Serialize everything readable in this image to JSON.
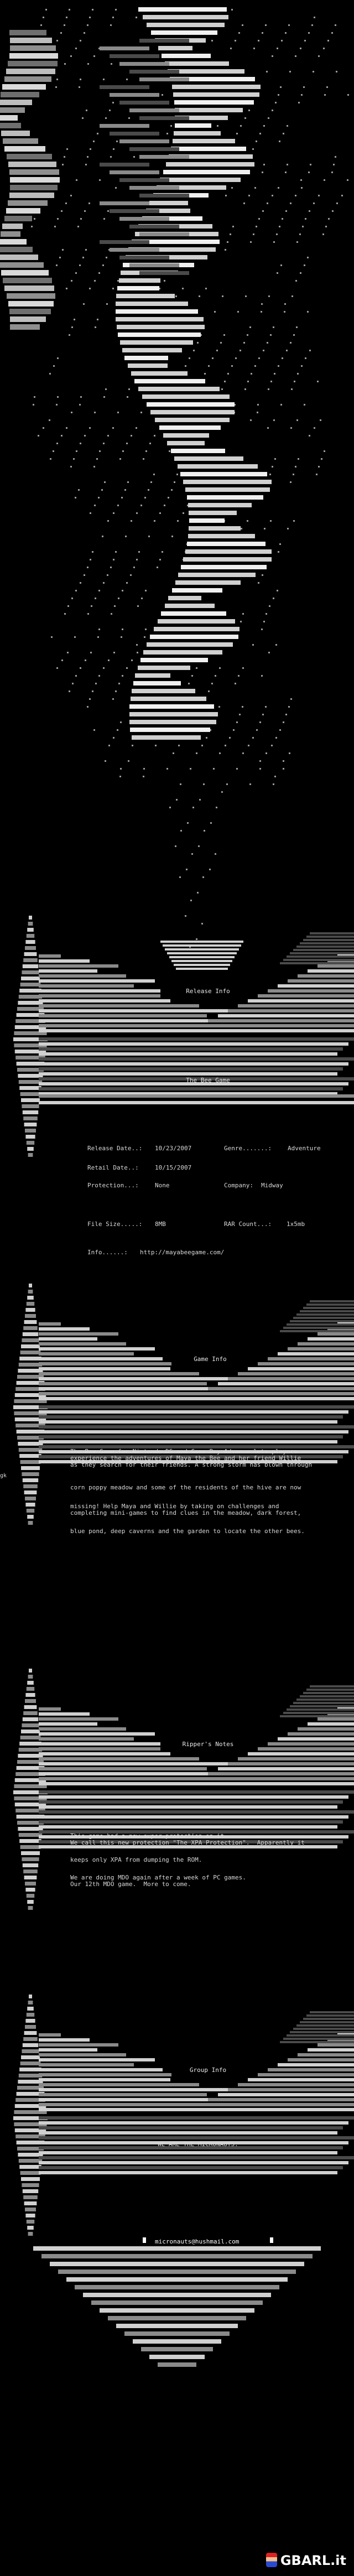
{
  "headers": {
    "release_info": "Release Info",
    "game_info": "Game Info",
    "rippers_notes": "Ripper's Notes",
    "group_info": "Group Info"
  },
  "game_title": "The Bee Game",
  "release": {
    "release_date_label": "Release Date..:",
    "release_date": "10/23/2007",
    "genre_label": "Genre.......:",
    "genre": "Adventure",
    "retail_date_label": "Retail Date..:",
    "retail_date": "10/15/2007",
    "protection_label": "Protection...:",
    "protection": "None",
    "company_label": "Company:",
    "company": "Midway",
    "file_size_label": "File Size.....:",
    "file_size": "8MB",
    "rar_count_label": "RAR Count...:",
    "rar_count": "1x5mb",
    "info_label": "Info......:",
    "info_url": "http://mayabeegame.com/"
  },
  "side_marker": "gk",
  "game_info_paragraphs": [
    "The Bee Game for Nintendo DS and Game Boy Advance lets players\nexperience the adventures of Maya the Bee and her friend Willie\nas they search for their friends. A strong storm has blown through",
    "corn poppy meadow and some of the residents of the hive are now",
    "missing! Help Maya and Willie by taking on challenges and\ncompleting mini-games to find clues in the meadow, dark forest,",
    "blue pond, deep caverns and the garden to locate the other bees."
  ],
  "ripper_paragraphs": [
    "This game had a new super protection on it.\nWe call this new protection \"The XPA Protection\".  Apparently it",
    "keeps only XPA from dumping the ROM.",
    "We are doing MDO again after a week of PC games.\nOur 12th MDO game.  More to come."
  ],
  "group_motto": "WE ARE THE MICRONAUTS.",
  "contact": "micronauts@hushmail.com",
  "watermark": "GBARL.it",
  "colors": {
    "background": "#000000",
    "text": "#d8d8d8",
    "bar_light": "#d0d0d0",
    "bar_mid": "#8a8a8a",
    "bar_dark": "#4a4a4a"
  }
}
